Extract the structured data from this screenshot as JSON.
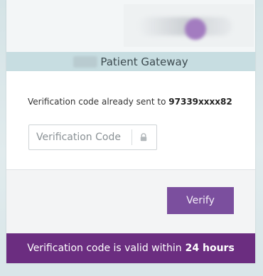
{
  "header": {
    "brand_name": "Patient Gateway"
  },
  "verification": {
    "sent_message": "Verification code already sent to",
    "masked_number": "97339xxxx82",
    "input_value": "",
    "input_placeholder": "Verification Code",
    "verify_label": "Verify"
  },
  "footer": {
    "validity_text": "Verification code is valid within",
    "validity_duration": "24 hours"
  },
  "colors": {
    "accent": "#7b4f9e",
    "footer_bar": "#6b2d80",
    "gateway_bar": "#c7dde1"
  },
  "icons": {
    "input_icon": "lock-icon"
  }
}
